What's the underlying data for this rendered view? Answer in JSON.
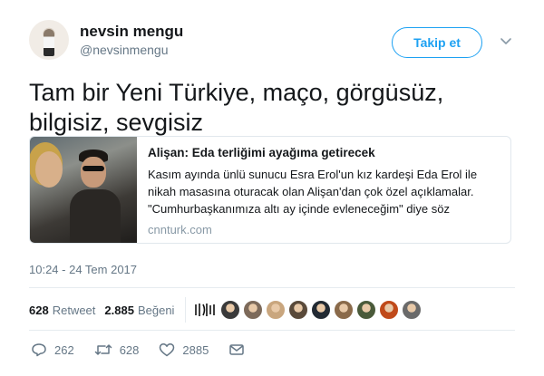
{
  "user": {
    "name": "nevsin mengu",
    "handle": "@nevsinmengu",
    "follow_label": "Takip et"
  },
  "tweet": {
    "text": "Tam bir Yeni Türkiye, maço, görgüsüz, bilgisiz, sevgisiz",
    "timestamp": "10:24 - 24 Tem 2017"
  },
  "card": {
    "title": "Alişan: Eda terliğimi ayağıma getirecek",
    "description": "Kasım ayında ünlü sunucu Esra Erol'un kız kardeşi Eda Erol ile nikah masasına oturacak olan Alişan'dan çok özel açıklamalar. \"Cumhurbaşkanımıza altı ay içinde evleneceğim\" diye söz",
    "domain": "cnnturk.com"
  },
  "stats": {
    "retweets": "628",
    "retweets_label": "Retweet",
    "likes": "2.885",
    "likes_label": "Beğeni",
    "liker_avatar_colors": [
      "#3a3a3a",
      "#7d6a5a",
      "#c9a67e",
      "#5a4a3a",
      "#222a33",
      "#8a6a4a",
      "#4a5a3a",
      "#c04a1a",
      "#6a6a6a"
    ]
  },
  "actions": {
    "replies": "262",
    "retweets": "628",
    "likes": "2885"
  },
  "colors": {
    "accent": "#1da1f2",
    "secondary_text": "#657786"
  },
  "icons": [
    "chevron-down-icon",
    "reply-icon",
    "retweet-icon",
    "heart-icon",
    "message-icon"
  ]
}
